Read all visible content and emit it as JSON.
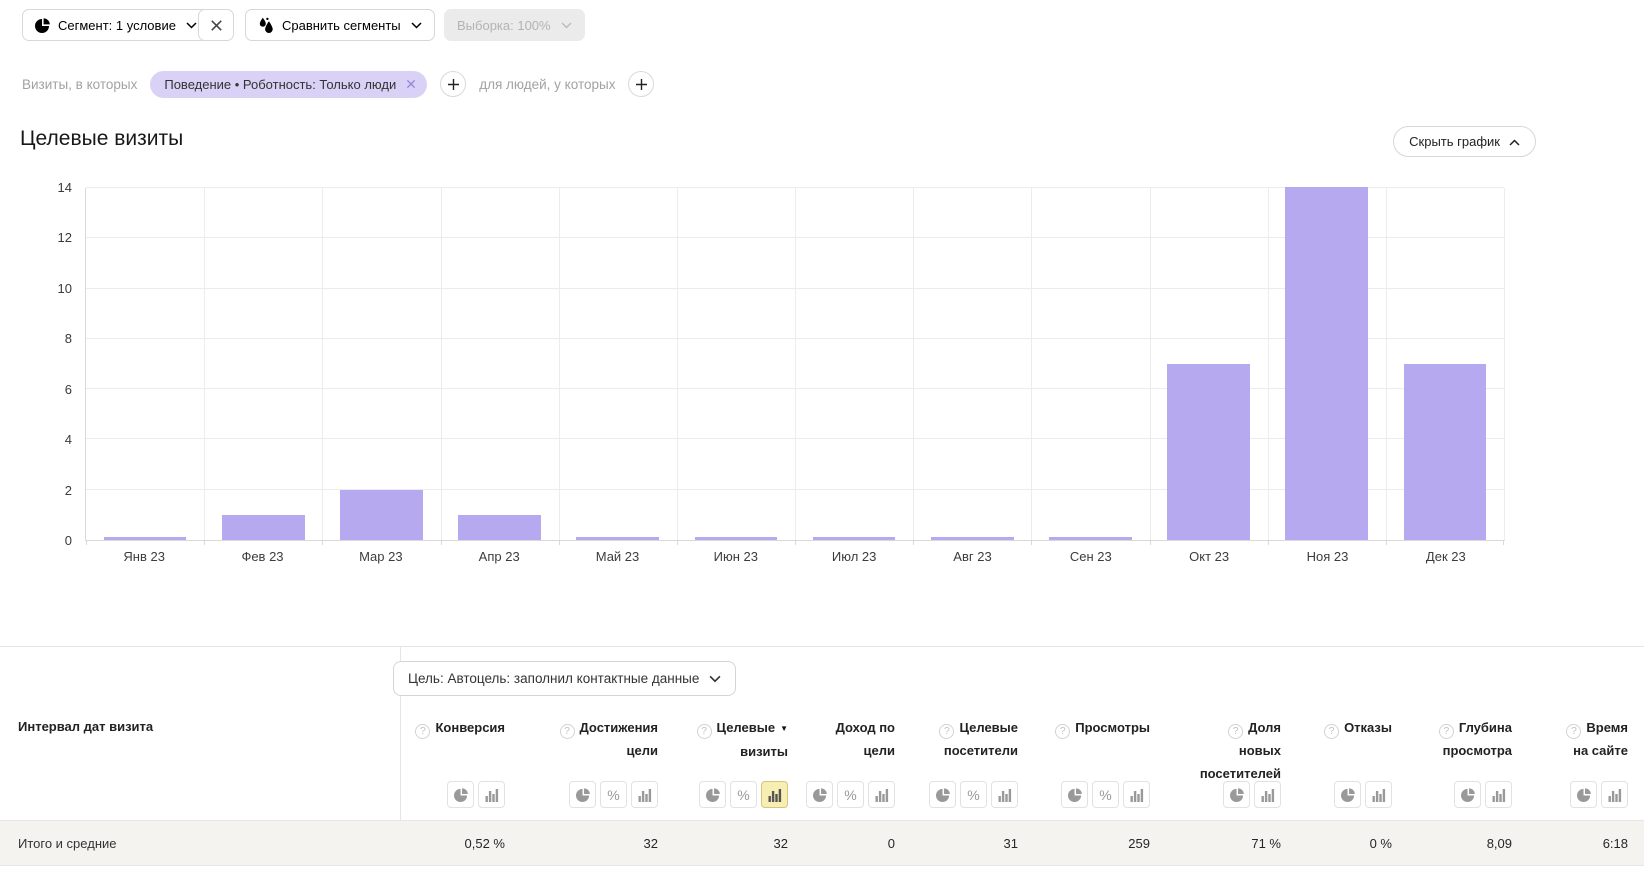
{
  "toolbar": {
    "segment": {
      "icon": "pie-chart-icon",
      "label": "Сегмент: 1 условие"
    },
    "compare": {
      "icon": "ab-droplets-icon",
      "label": "Сравнить сегменты"
    },
    "sampling": {
      "label": "Выборка: 100%"
    }
  },
  "segment_builder": {
    "visits_prefix": "Визиты, в которых",
    "chips": [
      {
        "label": "Поведение • Роботность: Только люди"
      }
    ],
    "people_prefix": "для людей, у которых"
  },
  "chart_section": {
    "title": "Целевые визиты",
    "hide_chart_label": "Скрыть график"
  },
  "chart_data": {
    "type": "bar",
    "title": "Целевые визиты",
    "categories": [
      "Янв 23",
      "Фев 23",
      "Мар 23",
      "Апр 23",
      "Май 23",
      "Июн 23",
      "Июл 23",
      "Авг 23",
      "Сен 23",
      "Окт 23",
      "Ноя 23",
      "Дек 23"
    ],
    "values": [
      0,
      1,
      2,
      1,
      0,
      0,
      0,
      0,
      0,
      7,
      14,
      7
    ],
    "xlabel": "",
    "ylabel": "",
    "ylim": [
      0,
      14
    ],
    "yticks": [
      0,
      2,
      4,
      6,
      8,
      10,
      12,
      14
    ],
    "grid": true,
    "legend_position": "none",
    "bar_color": "#b6a9f0"
  },
  "goal_selector": {
    "label": "Цель: Автоцель: заполнил контактные данные"
  },
  "table": {
    "date_interval_header": "Интервал дат визита",
    "totals_label": "Итого и средние",
    "columns": [
      {
        "label": "Конверсия",
        "lines": [
          "Конверсия"
        ],
        "help": true,
        "sorted": false,
        "toggles": [
          "pie",
          "bars"
        ],
        "selected_toggle": null,
        "total": "0,52 %"
      },
      {
        "label": "Достижения цели",
        "lines": [
          "Достижения",
          "цели"
        ],
        "help": true,
        "sorted": false,
        "toggles": [
          "pie",
          "percent",
          "bars"
        ],
        "selected_toggle": null,
        "total": "32"
      },
      {
        "label": "Целевые визиты",
        "lines": [
          "Целевые",
          "визиты"
        ],
        "help": true,
        "sorted": true,
        "toggles": [
          "pie",
          "percent",
          "bars"
        ],
        "selected_toggle": "bars",
        "total": "32"
      },
      {
        "label": "Доход по цели",
        "lines": [
          "Доход по",
          "цели"
        ],
        "help": false,
        "sorted": false,
        "toggles": [
          "pie",
          "percent",
          "bars"
        ],
        "selected_toggle": null,
        "total": "0"
      },
      {
        "label": "Целевые посетители",
        "lines": [
          "Целевые",
          "посетители"
        ],
        "help": true,
        "sorted": false,
        "toggles": [
          "pie",
          "percent",
          "bars"
        ],
        "selected_toggle": null,
        "total": "31"
      },
      {
        "label": "Просмотры",
        "lines": [
          "Просмотры"
        ],
        "help": true,
        "sorted": false,
        "toggles": [
          "pie",
          "percent",
          "bars"
        ],
        "selected_toggle": null,
        "total": "259"
      },
      {
        "label": "Доля новых посетителей",
        "lines": [
          "Доля",
          "новых",
          "посетителей"
        ],
        "help": true,
        "sorted": false,
        "toggles": [
          "pie",
          "bars"
        ],
        "selected_toggle": null,
        "total": "71 %"
      },
      {
        "label": "Отказы",
        "lines": [
          "Отказы"
        ],
        "help": true,
        "sorted": false,
        "toggles": [
          "pie",
          "bars"
        ],
        "selected_toggle": null,
        "total": "0 %"
      },
      {
        "label": "Глубина просмотра",
        "lines": [
          "Глубина",
          "просмотра"
        ],
        "help": true,
        "sorted": false,
        "toggles": [
          "pie",
          "bars"
        ],
        "selected_toggle": null,
        "total": "8,09"
      },
      {
        "label": "Время на сайте",
        "lines": [
          "Время",
          "на сайте"
        ],
        "help": true,
        "sorted": false,
        "toggles": [
          "pie",
          "bars"
        ],
        "selected_toggle": null,
        "total": "6:18"
      }
    ]
  },
  "colors": {
    "bar": "#b6a9f0",
    "chip_bg": "#dad2f6",
    "toggle_selected_bg": "#f7eeb3"
  }
}
